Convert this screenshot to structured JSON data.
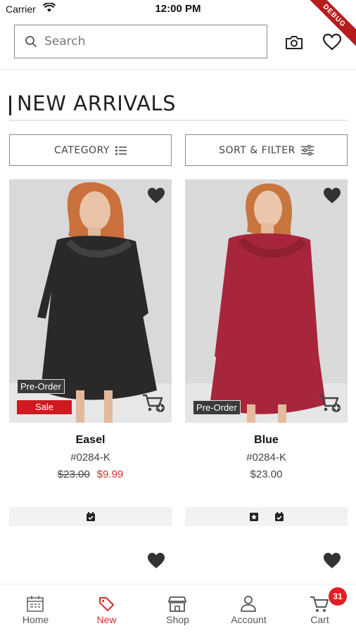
{
  "status_bar": {
    "carrier": "Carrier",
    "time": "12:00 PM",
    "debug_label": "DEBUG"
  },
  "search": {
    "placeholder": "Search"
  },
  "page": {
    "title": "NEW ARRIVALS"
  },
  "filters": {
    "category_label": "CATEGORY",
    "sort_filter_label": "SORT & FILTER"
  },
  "products": [
    {
      "name": "Easel",
      "sku": "#0284-K",
      "original_price": "$23.00",
      "sale_price": "$9.99",
      "badges": [
        "Pre-Order",
        "Sale"
      ],
      "dress_color": "#2a2828",
      "strip_icons": [
        "calendar-check-icon"
      ]
    },
    {
      "name": "Blue",
      "sku": "#0284-K",
      "price": "$23.00",
      "badges": [
        "Pre-Order"
      ],
      "dress_color": "#a8263b",
      "strip_icons": [
        "star-box-icon",
        "calendar-check-icon"
      ]
    }
  ],
  "tab_bar": {
    "items": [
      {
        "label": "Home",
        "icon": "calendar-icon"
      },
      {
        "label": "New",
        "icon": "tag-icon",
        "active": true
      },
      {
        "label": "Shop",
        "icon": "storefront-icon"
      },
      {
        "label": "Account",
        "icon": "person-icon"
      },
      {
        "label": "Cart",
        "icon": "cart-icon"
      }
    ],
    "cart_count": "31"
  },
  "colors": {
    "accent": "#d32f2f",
    "sale_badge": "#d0191f",
    "cart_badge": "#e01e23"
  }
}
